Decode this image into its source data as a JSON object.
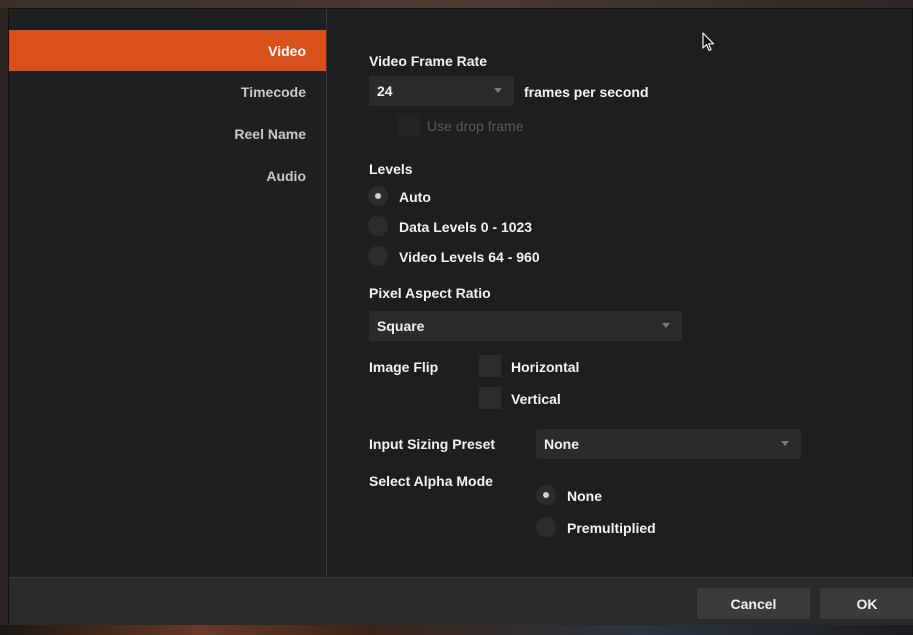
{
  "sidebar": {
    "items": [
      {
        "label": "Video"
      },
      {
        "label": "Timecode"
      },
      {
        "label": "Reel Name"
      },
      {
        "label": "Audio"
      }
    ]
  },
  "video": {
    "frame_rate_label": "Video Frame Rate",
    "frame_rate_value": "24",
    "frame_rate_unit": "frames per second",
    "drop_frame_label": "Use drop frame",
    "levels_label": "Levels",
    "levels_options": [
      "Auto",
      "Data Levels 0 - 1023",
      "Video Levels 64 - 960"
    ],
    "levels_selected": "Auto",
    "pixel_aspect_label": "Pixel Aspect Ratio",
    "pixel_aspect_value": "Square",
    "image_flip_label": "Image Flip",
    "flip_horizontal_label": "Horizontal",
    "flip_vertical_label": "Vertical",
    "input_sizing_label": "Input Sizing Preset",
    "input_sizing_value": "None",
    "alpha_label": "Select Alpha Mode",
    "alpha_options": [
      "None",
      "Premultiplied"
    ],
    "alpha_selected": "None"
  },
  "footer": {
    "cancel_label": "Cancel",
    "ok_label": "OK"
  },
  "colors": {
    "accent": "#d8511d",
    "panel": "#1f1f21"
  }
}
